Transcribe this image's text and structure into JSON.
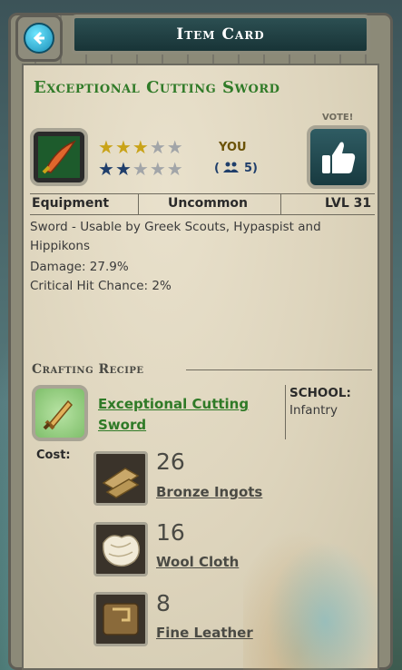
{
  "header": {
    "title": "Item Card"
  },
  "item": {
    "name": "Exceptional Cutting Sword",
    "your_rating_label": "YOU",
    "your_rating": 3,
    "community_rating": 2,
    "rating_max": 5,
    "votes_count_prefix": "(",
    "votes_count": "5)",
    "vote_label": "VOTE!",
    "type": "Equipment",
    "rarity": "Uncommon",
    "level": "LVL 31",
    "description_lines": [
      "Sword - Usable by Greek Scouts, Hypaspist and",
      "Hippikons",
      "Damage:  27.9%",
      "Critical Hit Chance:  2%"
    ]
  },
  "recipe": {
    "section_title": "Crafting Recipe",
    "name_line1": "Exceptional Cutting",
    "name_line2": "Sword",
    "school_label": "SCHOOL:",
    "school_value": "Infantry",
    "cost_label": "Cost:",
    "materials": [
      {
        "qty": "26",
        "name": "Bronze Ingots",
        "icon": "bronze-ingots-icon"
      },
      {
        "qty": "16",
        "name": "Wool Cloth",
        "icon": "wool-cloth-icon"
      },
      {
        "qty": "8",
        "name": "Fine Leather",
        "icon": "fine-leather-icon"
      }
    ]
  },
  "colors": {
    "item_name": "#2f7a27",
    "gold_star": "#c9a318",
    "blue_star": "#1f3e6b",
    "parchment": "#ddd4bc"
  }
}
